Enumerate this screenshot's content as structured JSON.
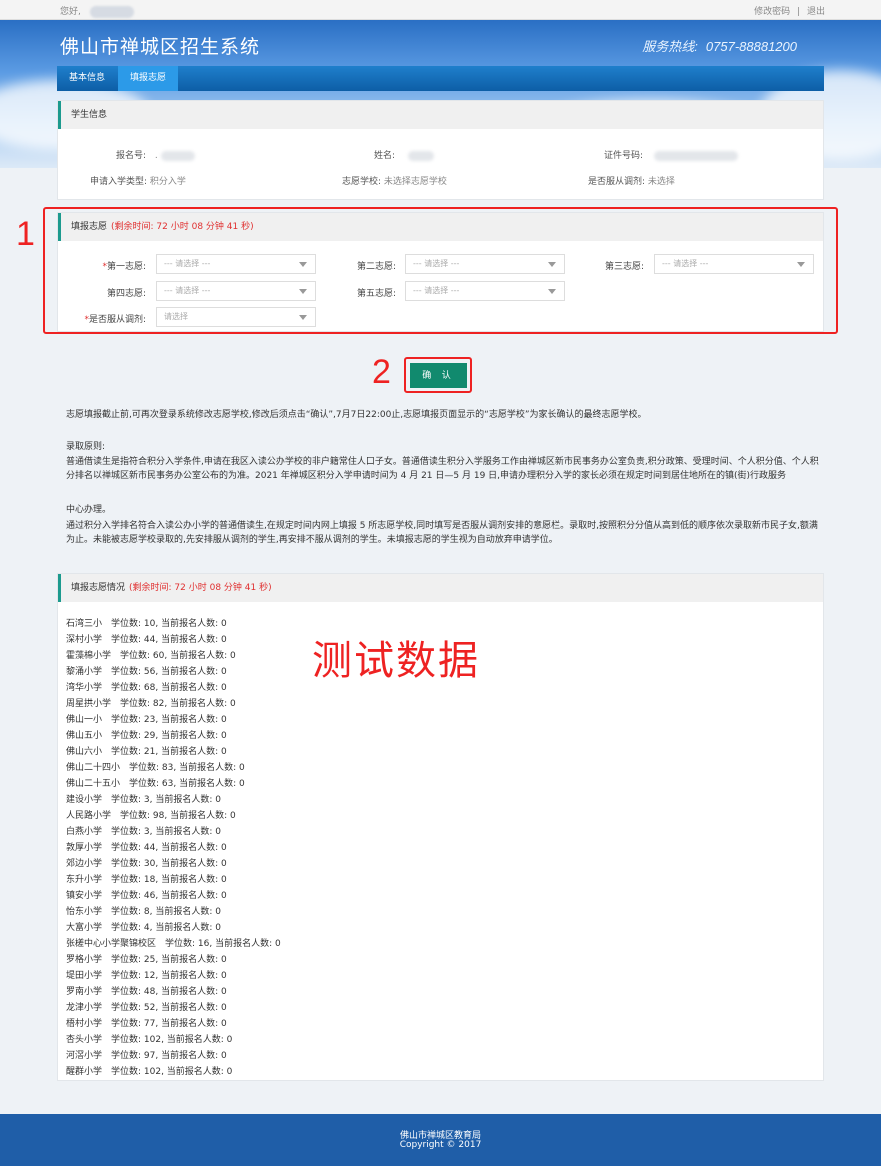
{
  "topbar": {
    "greeting": "您好,",
    "change_password": "修改密码",
    "separator": "|",
    "logout": "退出"
  },
  "header": {
    "site_title": "佛山市禅城区招生系统",
    "hotline_label": "服务热线:",
    "hotline_number": "0757-88881200"
  },
  "nav": {
    "tabs": [
      {
        "label": "基本信息",
        "active": false
      },
      {
        "label": "填报志愿",
        "active": true
      }
    ]
  },
  "student_info": {
    "title": "学生信息",
    "reg_no_label": "报名号:",
    "reg_no_value": ".",
    "name_label": "姓名:",
    "id_label": "证件号码:",
    "type_label": "申请入学类型:",
    "type_value": "积分入学",
    "school_label": "志愿学校:",
    "school_value": "未选择志愿学校",
    "adjust_label": "是否服从调剂:",
    "adjust_value": "未选择"
  },
  "choices": {
    "title": "填报志愿",
    "remaining": "(剩余时间: 72 小时 08 分钟 41 秒)",
    "first_label": "第一志愿:",
    "second_label": "第二志愿:",
    "third_label": "第三志愿:",
    "fourth_label": "第四志愿:",
    "fifth_label": "第五志愿:",
    "adjust_label": "是否服从调剂:",
    "placeholder": "--- 请选择 ---",
    "adjust_placeholder": "请选择",
    "required_mark": "*"
  },
  "annotations": {
    "box1_number": "1",
    "box2_number": "2",
    "test_data": "测试数据"
  },
  "confirm_button": "确 认",
  "notice": {
    "deadline": "志愿填报截止前,可再次登录系统修改志愿学校,修改后须点击“确认”,7月7日22:00止,志愿填报页面显示的“志愿学校”为家长确认的最终志愿学校。",
    "principle_title": "录取原则:",
    "p1": "普通借读生是指符合积分入学条件,申请在我区入读公办学校的非户籍常住人口子女。普通借读生积分入学服务工作由禅城区新市民事务办公室负责,积分政策、受理时间、个人积分值、个人积分排名以禅城区新市民事务办公室公布的为准。2021 年禅城区积分入学申请时间为 4 月 21 日—5 月 19 日,申请办理积分入学的家长必须在规定时间到居住地所在的镇(街)行政服务",
    "p2": "中心办理。",
    "p3": "通过积分入学排名符合入读公办小学的普通借读生,在规定时间内网上填报 5 所志愿学校,同时填写是否服从调剂安排的意愿栏。录取时,按照积分分值从高到低的顺序依次录取新市民子女,额满为止。未能被志愿学校录取的,先安排服从调剂的学生,再安排不服从调剂的学生。未填报志愿的学生视为自动放弃申请学位。"
  },
  "status": {
    "title": "填报志愿情况",
    "remaining": "(剩余时间: 72 小时 08 分钟 41 秒)",
    "schools": [
      "石湾三小　学位数: 10, 当前报名人数: 0",
      "深村小学　学位数: 44, 当前报名人数: 0",
      "霍藻棉小学　学位数: 60, 当前报名人数: 0",
      "黎涌小学　学位数: 56, 当前报名人数: 0",
      "湾华小学　学位数: 68, 当前报名人数: 0",
      "周星拱小学　学位数: 82, 当前报名人数: 0",
      "佛山一小　学位数: 23, 当前报名人数: 0",
      "佛山五小　学位数: 29, 当前报名人数: 0",
      "佛山六小　学位数: 21, 当前报名人数: 0",
      "佛山二十四小　学位数: 83, 当前报名人数: 0",
      "佛山二十五小　学位数: 63, 当前报名人数: 0",
      "建设小学　学位数: 3, 当前报名人数: 0",
      "人民路小学　学位数: 98, 当前报名人数: 0",
      "白燕小学　学位数: 3, 当前报名人数: 0",
      "敦厚小学　学位数: 44, 当前报名人数: 0",
      "郊边小学　学位数: 30, 当前报名人数: 0",
      "东升小学　学位数: 18, 当前报名人数: 0",
      "镇安小学　学位数: 46, 当前报名人数: 0",
      "怡东小学　学位数: 8, 当前报名人数: 0",
      "大富小学　学位数: 4, 当前报名人数: 0",
      "张槎中心小学聚锦校区　学位数: 16, 当前报名人数: 0",
      "罗格小学　学位数: 25, 当前报名人数: 0",
      "堤田小学　学位数: 12, 当前报名人数: 0",
      "罗南小学　学位数: 48, 当前报名人数: 0",
      "龙津小学　学位数: 52, 当前报名人数: 0",
      "梧村小学　学位数: 77, 当前报名人数: 0",
      "杏头小学　学位数: 102, 当前报名人数: 0",
      "河滘小学　学位数: 97, 当前报名人数: 0",
      "醒群小学　学位数: 102, 当前报名人数: 0"
    ]
  },
  "footer": {
    "org": "佛山市禅城区教育局",
    "copyright": "Copyright © 2017"
  },
  "colors": {
    "accent_green": "#118a6e",
    "nav_blue": "#0d5ea6",
    "warn_red": "#e03030",
    "annotation_red": "#ee2222",
    "footer_blue": "#1f5ea8"
  }
}
